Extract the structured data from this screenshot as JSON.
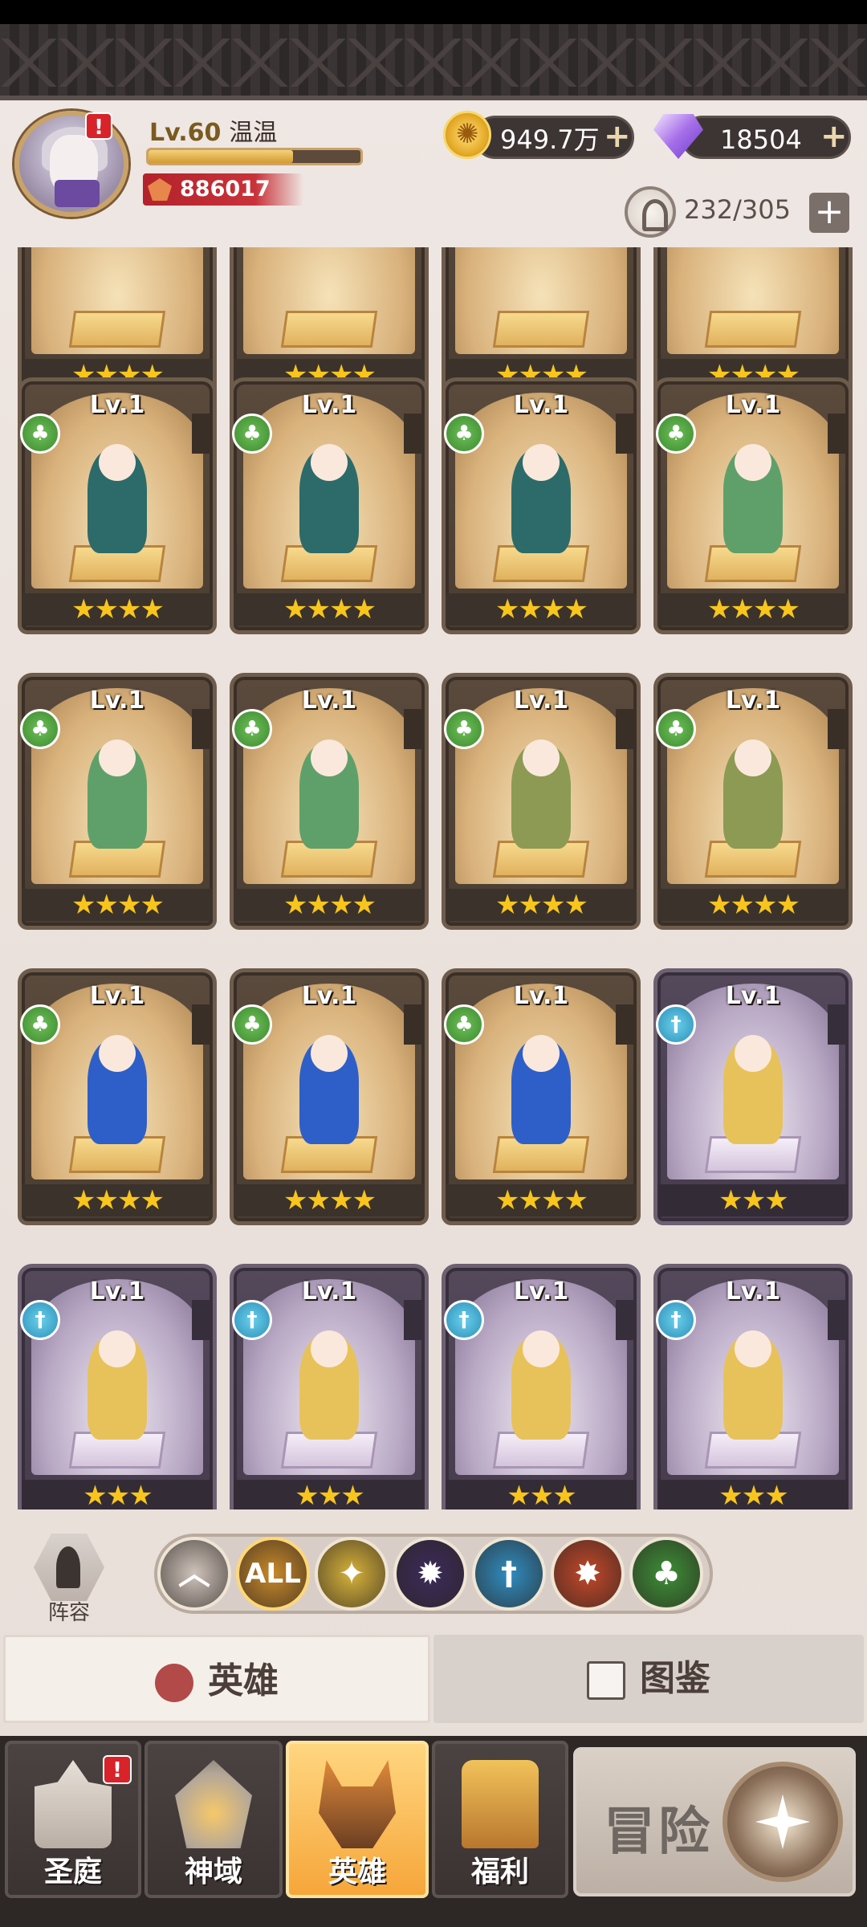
{
  "player": {
    "level": "Lv.60",
    "name": "温温",
    "power": "886017",
    "exp_fraction": 0.68,
    "alert": "!"
  },
  "resources": {
    "gold": "949.7万",
    "diamonds": "18504",
    "heroes_count": "232/305"
  },
  "heroes": [
    {
      "level": "",
      "stars": "★★★★",
      "class": "nature",
      "theme": "gold"
    },
    {
      "level": "",
      "stars": "★★★★",
      "class": "nature",
      "theme": "gold"
    },
    {
      "level": "",
      "stars": "★★★★",
      "class": "nature",
      "theme": "gold"
    },
    {
      "level": "",
      "stars": "★★★★",
      "class": "nature",
      "theme": "gold"
    },
    {
      "level": "Lv.1",
      "stars": "★★★★",
      "class": "nature",
      "theme": "gold",
      "figure_color": "#2c6b6a"
    },
    {
      "level": "Lv.1",
      "stars": "★★★★",
      "class": "nature",
      "theme": "gold",
      "figure_color": "#2c6b6a"
    },
    {
      "level": "Lv.1",
      "stars": "★★★★",
      "class": "nature",
      "theme": "gold",
      "figure_color": "#2c6b6a"
    },
    {
      "level": "Lv.1",
      "stars": "★★★★",
      "class": "nature",
      "theme": "gold",
      "figure_color": "#5fa06a"
    },
    {
      "level": "Lv.1",
      "stars": "★★★★",
      "class": "nature",
      "theme": "gold",
      "figure_color": "#5fa06a"
    },
    {
      "level": "Lv.1",
      "stars": "★★★★",
      "class": "nature",
      "theme": "gold",
      "figure_color": "#5fa06a"
    },
    {
      "level": "Lv.1",
      "stars": "★★★★",
      "class": "nature",
      "theme": "gold",
      "figure_color": "#8c9a54"
    },
    {
      "level": "Lv.1",
      "stars": "★★★★",
      "class": "nature",
      "theme": "gold",
      "figure_color": "#8c9a54"
    },
    {
      "level": "Lv.1",
      "stars": "★★★★",
      "class": "nature",
      "theme": "gold",
      "figure_color": "#2e5fc9"
    },
    {
      "level": "Lv.1",
      "stars": "★★★★",
      "class": "nature",
      "theme": "gold",
      "figure_color": "#2e5fc9"
    },
    {
      "level": "Lv.1",
      "stars": "★★★★",
      "class": "nature",
      "theme": "gold",
      "figure_color": "#2e5fc9"
    },
    {
      "level": "Lv.1",
      "stars": "★★★",
      "class": "holy",
      "theme": "purple",
      "figure_color": "#e7c25a"
    },
    {
      "level": "Lv.1",
      "stars": "★★★",
      "class": "holy",
      "theme": "purple",
      "figure_color": "#e7c25a"
    },
    {
      "level": "Lv.1",
      "stars": "★★★",
      "class": "holy",
      "theme": "purple",
      "figure_color": "#e7c25a"
    },
    {
      "level": "Lv.1",
      "stars": "★★★",
      "class": "holy",
      "theme": "purple",
      "figure_color": "#e7c25a"
    },
    {
      "level": "Lv.1",
      "stars": "★★★",
      "class": "holy",
      "theme": "purple",
      "figure_color": "#e7c25a"
    }
  ],
  "lineup": {
    "label": "阵容"
  },
  "filters": [
    {
      "icon": "chevron-up-icon",
      "glyph": "︿",
      "color": "#cfc4bb"
    },
    {
      "icon": "all-filter",
      "glyph": "ALL",
      "color": "#c8892a"
    },
    {
      "icon": "light-class-icon",
      "glyph": "✦",
      "color": "#d7b23a"
    },
    {
      "icon": "dark-class-icon",
      "glyph": "✹",
      "color": "#3c2b5a"
    },
    {
      "icon": "holy-class-icon",
      "glyph": "†",
      "color": "#2f8dc0"
    },
    {
      "icon": "beast-class-icon",
      "glyph": "✸",
      "color": "#c2482a"
    },
    {
      "icon": "nature-class-icon",
      "glyph": "♣",
      "color": "#3d8f37"
    }
  ],
  "tabs": {
    "heroes": "英雄",
    "codex": "图鉴"
  },
  "nav": {
    "sanctuary": "圣庭",
    "divine": "神域",
    "heroes": "英雄",
    "welfare": "福利",
    "adventure": "冒险"
  }
}
